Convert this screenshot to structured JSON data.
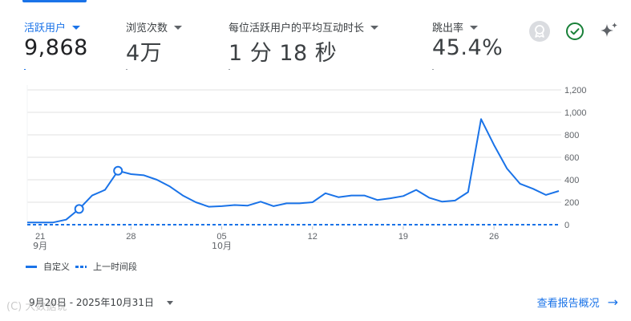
{
  "metrics": [
    {
      "label": "活跃用户",
      "value": "9,868",
      "active": true
    },
    {
      "label": "浏览次数",
      "value": "4万",
      "active": false
    },
    {
      "label": "每位活跃用户的平均互动时长",
      "value": "1 分 18 秒",
      "active": false
    },
    {
      "label": "跳出率",
      "value": "45.4%",
      "active": false
    }
  ],
  "toolbar_icons": [
    "badge-icon",
    "check-circle-icon",
    "sparkle-icon"
  ],
  "colors": {
    "accent": "#1a73e8",
    "grid": "#e0e0e0",
    "check": "#188038"
  },
  "chart_data": {
    "type": "line",
    "x_ticks": [
      {
        "day": 1,
        "label": "21",
        "sub": "9月"
      },
      {
        "day": 8,
        "label": "28",
        "sub": ""
      },
      {
        "day": 15,
        "label": "05",
        "sub": "10月"
      },
      {
        "day": 22,
        "label": "12",
        "sub": ""
      },
      {
        "day": 29,
        "label": "19",
        "sub": ""
      },
      {
        "day": 36,
        "label": "26",
        "sub": ""
      }
    ],
    "ylim": [
      0,
      1200
    ],
    "y_ticks": [
      "0",
      "200",
      "400",
      "600",
      "800",
      "1,000",
      "1,200"
    ],
    "series": [
      {
        "name": "自定义",
        "style": "solid",
        "x": [
          "2025-09-20",
          "2025-09-21",
          "2025-09-22",
          "2025-09-23",
          "2025-09-24",
          "2025-09-25",
          "2025-09-26",
          "2025-09-27",
          "2025-09-28",
          "2025-09-29",
          "2025-09-30",
          "2025-10-01",
          "2025-10-02",
          "2025-10-03",
          "2025-10-04",
          "2025-10-05",
          "2025-10-06",
          "2025-10-07",
          "2025-10-08",
          "2025-10-09",
          "2025-10-10",
          "2025-10-11",
          "2025-10-12",
          "2025-10-13",
          "2025-10-14",
          "2025-10-15",
          "2025-10-16",
          "2025-10-17",
          "2025-10-18",
          "2025-10-19",
          "2025-10-20",
          "2025-10-21",
          "2025-10-22",
          "2025-10-23",
          "2025-10-24",
          "2025-10-25",
          "2025-10-26",
          "2025-10-27",
          "2025-10-28",
          "2025-10-29",
          "2025-10-30",
          "2025-10-31"
        ],
        "values": [
          20,
          20,
          20,
          45,
          140,
          260,
          310,
          480,
          450,
          440,
          400,
          340,
          260,
          200,
          160,
          165,
          175,
          170,
          205,
          165,
          190,
          190,
          200,
          280,
          245,
          260,
          260,
          220,
          235,
          255,
          310,
          240,
          205,
          215,
          290,
          940,
          710,
          500,
          365,
          320,
          265,
          300
        ],
        "markers": [
          4,
          7
        ]
      },
      {
        "name": "上一时间段",
        "style": "dashed",
        "values": [
          0
        ]
      }
    ]
  },
  "footer": {
    "date_range": "9月20日 - 2025年10月31日",
    "report_link": "查看报告概况",
    "watermark": "(C) 大数据说"
  }
}
